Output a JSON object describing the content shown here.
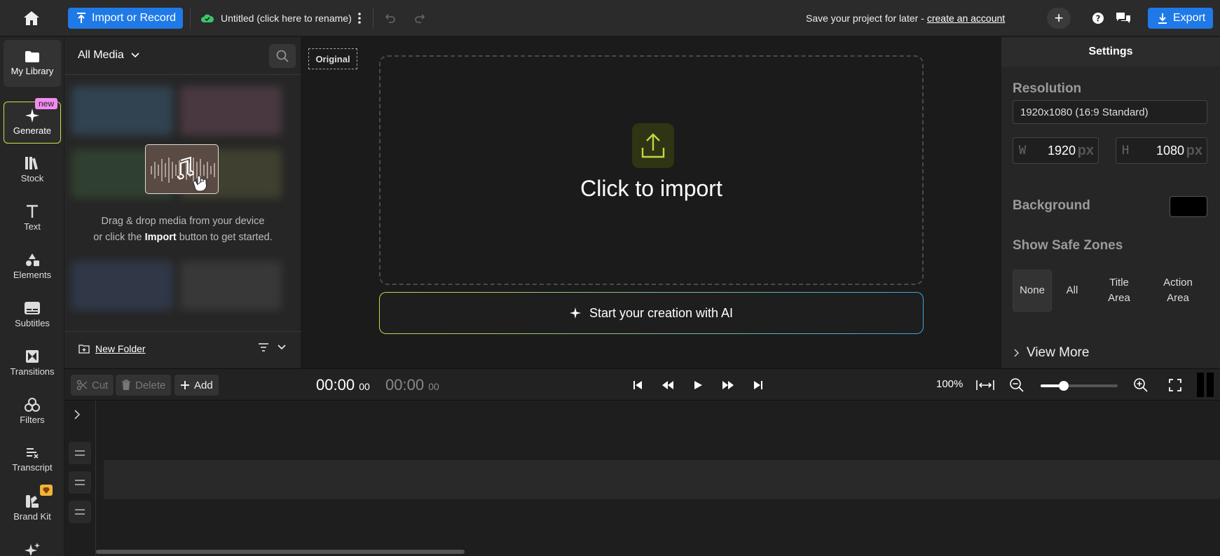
{
  "topbar": {
    "import_label": "Import or Record",
    "project_title": "Untitled (click here to rename)",
    "save_prompt": "Save your project for later -",
    "create_account": "create an account",
    "plus": "+",
    "export_label": "Export"
  },
  "nav": [
    {
      "label": "My Library",
      "icon": "folder-icon"
    },
    {
      "label": "Generate",
      "icon": "sparkle-icon",
      "badge": "new"
    },
    {
      "label": "Stock",
      "icon": "books-icon"
    },
    {
      "label": "Text",
      "icon": "text-icon"
    },
    {
      "label": "Elements",
      "icon": "shapes-icon"
    },
    {
      "label": "Subtitles",
      "icon": "subtitles-icon"
    },
    {
      "label": "Transitions",
      "icon": "transitions-icon"
    },
    {
      "label": "Filters",
      "icon": "filters-icon"
    },
    {
      "label": "Transcript",
      "icon": "transcript-icon"
    },
    {
      "label": "Brand Kit",
      "icon": "brand-kit-icon"
    }
  ],
  "library": {
    "filter": "All Media",
    "empty_line1": "Drag & drop media from your device",
    "empty_line2_pre": "or click the",
    "empty_line2_bold": "Import",
    "empty_line2_post": "button to get started.",
    "new_folder": "New Folder"
  },
  "canvas": {
    "original_tag": "Original",
    "click_import": "Click to import",
    "ai_button": "Start your creation with AI"
  },
  "settings": {
    "title": "Settings",
    "resolution_label": "Resolution",
    "resolution_value": "1920x1080 (16:9 Standard)",
    "width_key": "W",
    "width_value": "1920",
    "height_key": "H",
    "height_value": "1080",
    "unit": "px",
    "background_label": "Background",
    "background_color": "#000000",
    "safe_zones_label": "Show Safe Zones",
    "zones": [
      "None",
      "All",
      "Title Area",
      "Action Area"
    ],
    "selected_zone": "None",
    "view_more": "View More"
  },
  "timeline": {
    "cut": "Cut",
    "delete": "Delete",
    "add": "Add",
    "current_main": "00:00",
    "current_frames": "00",
    "total_main": "00:00",
    "total_frames": "00",
    "zoom_percent": "100%",
    "zoom_level": 0.3
  },
  "colors": {
    "accent": "#1f7ae8",
    "new_badge": "#f18cf1",
    "gem_badge": "#f3b23b"
  }
}
